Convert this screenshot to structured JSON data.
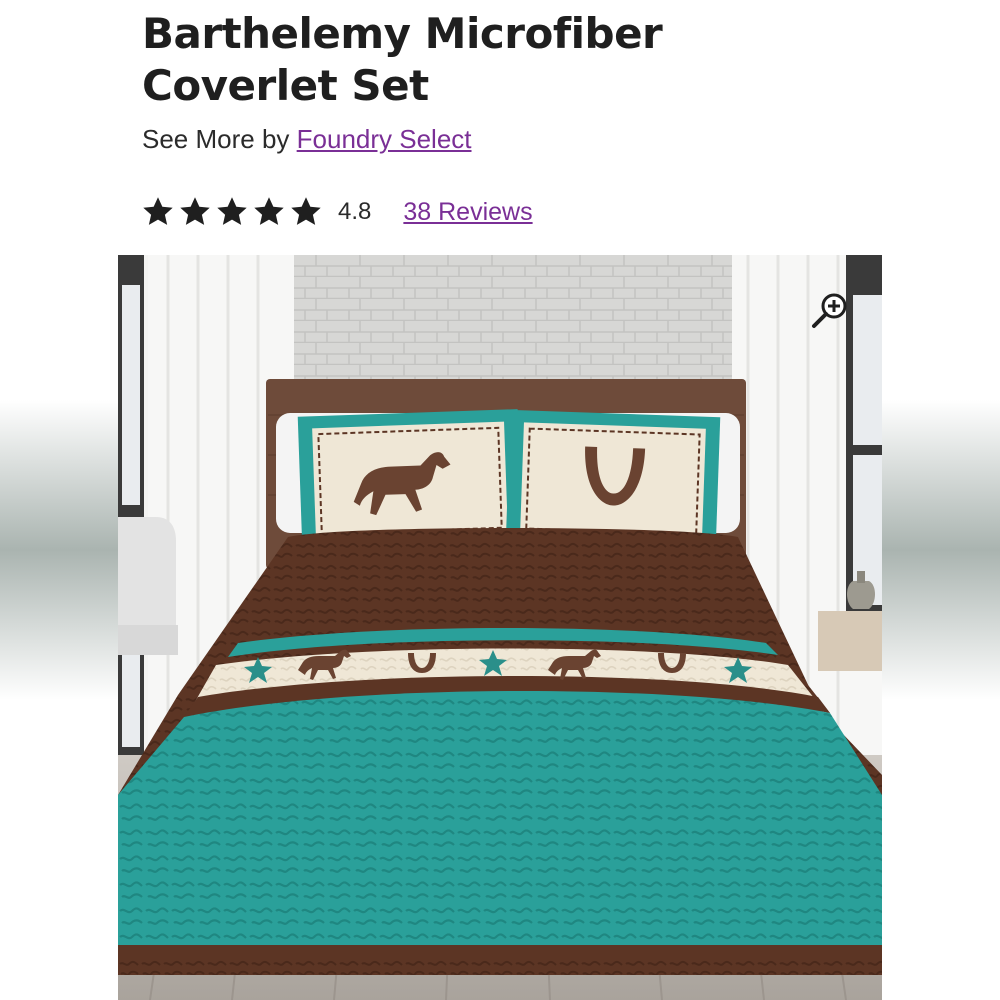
{
  "product": {
    "title": "Barthelemy Microfiber Coverlet Set",
    "see_more_prefix": "See More by",
    "brand": "Foundry Select"
  },
  "rating": {
    "value": "4.8",
    "score": 4.8,
    "max": 5,
    "reviews_label": "38 Reviews"
  },
  "image": {
    "subject": "bed with turquoise and brown western coverlet and shams",
    "zoom_icon": "zoom-in-icon"
  },
  "colors": {
    "link": "#7a2f96",
    "text": "#1f1f1f",
    "star": "#1f1f1f",
    "turquoise": "#2a9d98",
    "brown": "#5a3322",
    "cream": "#efe7d6"
  }
}
